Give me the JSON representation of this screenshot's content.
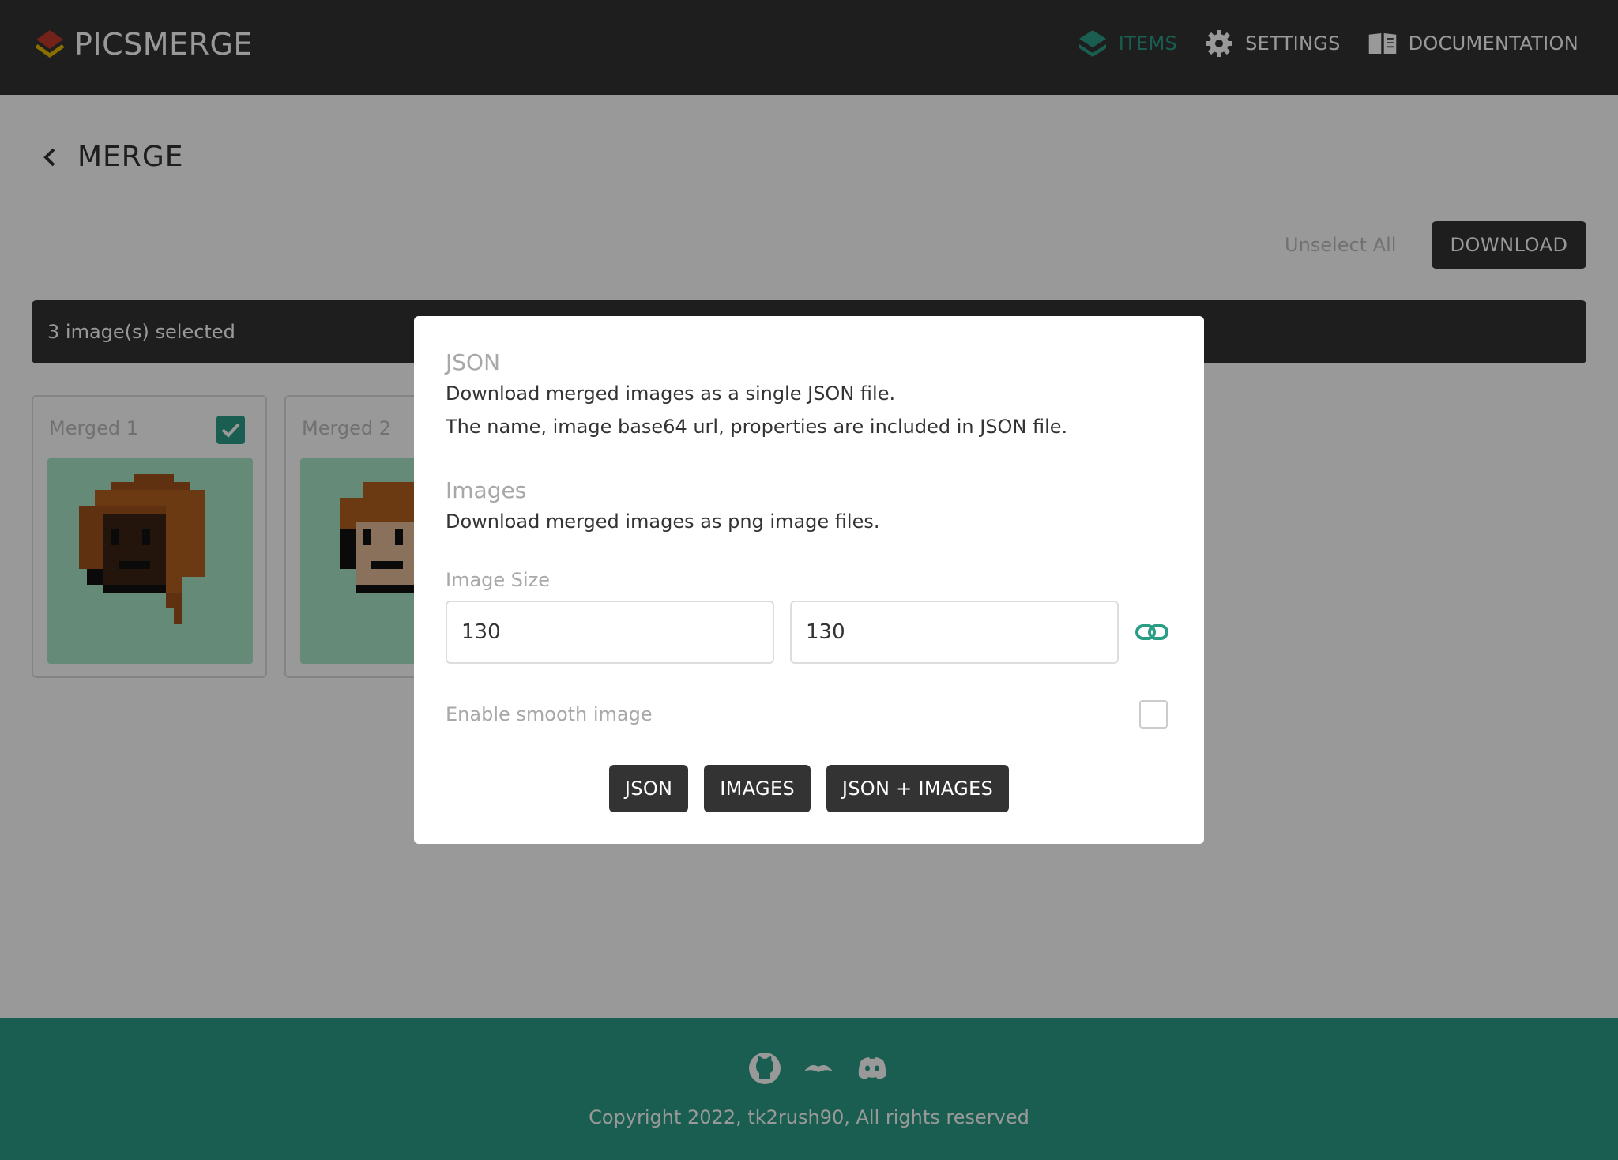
{
  "app": {
    "name": "PICSMERGE",
    "logo_icon": "layers-logo-icon"
  },
  "nav": {
    "items": [
      {
        "label": "ITEMS",
        "icon": "layers-icon",
        "active": true
      },
      {
        "label": "SETTINGS",
        "icon": "gear-icon",
        "active": false
      },
      {
        "label": "DOCUMENTATION",
        "icon": "book-icon",
        "active": false
      }
    ]
  },
  "page": {
    "title": "MERGE",
    "back_icon": "chevron-left-icon"
  },
  "toolbar": {
    "unselect_label": "Unselect All",
    "download_label": "DOWNLOAD"
  },
  "selection": {
    "text": "3 image(s) selected"
  },
  "cards": [
    {
      "label": "Merged 1",
      "checked": true
    },
    {
      "label": "Merged 2",
      "checked": true
    }
  ],
  "modal": {
    "json_title": "JSON",
    "json_desc_1": "Download merged images as a single JSON file.",
    "json_desc_2": "The name, image base64 url, properties are included in JSON file.",
    "images_title": "Images",
    "images_desc": "Download merged images as png image files.",
    "image_size_label": "Image Size",
    "width_value": "130",
    "height_value": "130",
    "link_icon": "link-icon",
    "smooth_label": "Enable smooth image",
    "smooth_checked": false,
    "buttons": {
      "json": "JSON",
      "images": "IMAGES",
      "json_images": "JSON + IMAGES"
    }
  },
  "footer": {
    "icons": [
      "github-icon",
      "opensea-icon",
      "discord-icon"
    ],
    "copyright": "Copyright 2022, tk2rush90, All rights reserved"
  },
  "colors": {
    "accent": "#2a9d85",
    "dark": "#333333",
    "muted": "#a8a8a8"
  }
}
